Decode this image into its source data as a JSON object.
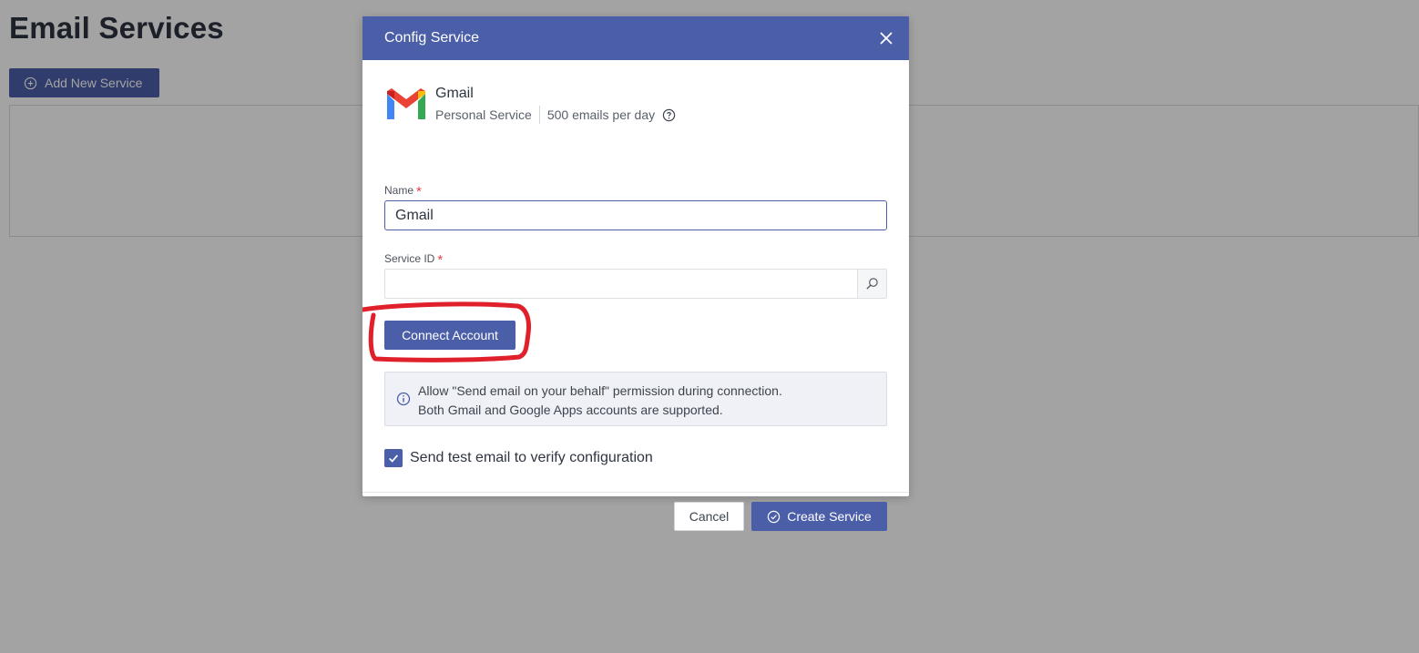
{
  "page": {
    "title": "Email Services",
    "add_button_label": "Add New Service"
  },
  "modal": {
    "title": "Config Service",
    "provider": {
      "name": "Gmail",
      "type": "Personal Service",
      "limit": "500 emails per day"
    },
    "name_field": {
      "label": "Name",
      "required_mark": "*",
      "value": "Gmail"
    },
    "service_id_field": {
      "label": "Service ID",
      "required_mark": "*",
      "value": ""
    },
    "connect_button_label": "Connect Account",
    "info": {
      "line1": "Allow \"Send email on your behalf\" permission during connection.",
      "line2": "Both Gmail and Google Apps accounts are supported."
    },
    "test_email": {
      "label": "Send test email to verify configuration",
      "checked": true
    },
    "cancel_label": "Cancel",
    "create_label": "Create Service"
  },
  "colors": {
    "primary": "#4b5ea8",
    "annotation": "#e0202a",
    "overlay": "rgba(0,0,0,0.36)"
  },
  "icons": [
    "add-circle-icon",
    "gmail-logo",
    "help-icon",
    "close-icon",
    "search-icon",
    "info-icon",
    "check-icon",
    "check-circle-icon"
  ]
}
